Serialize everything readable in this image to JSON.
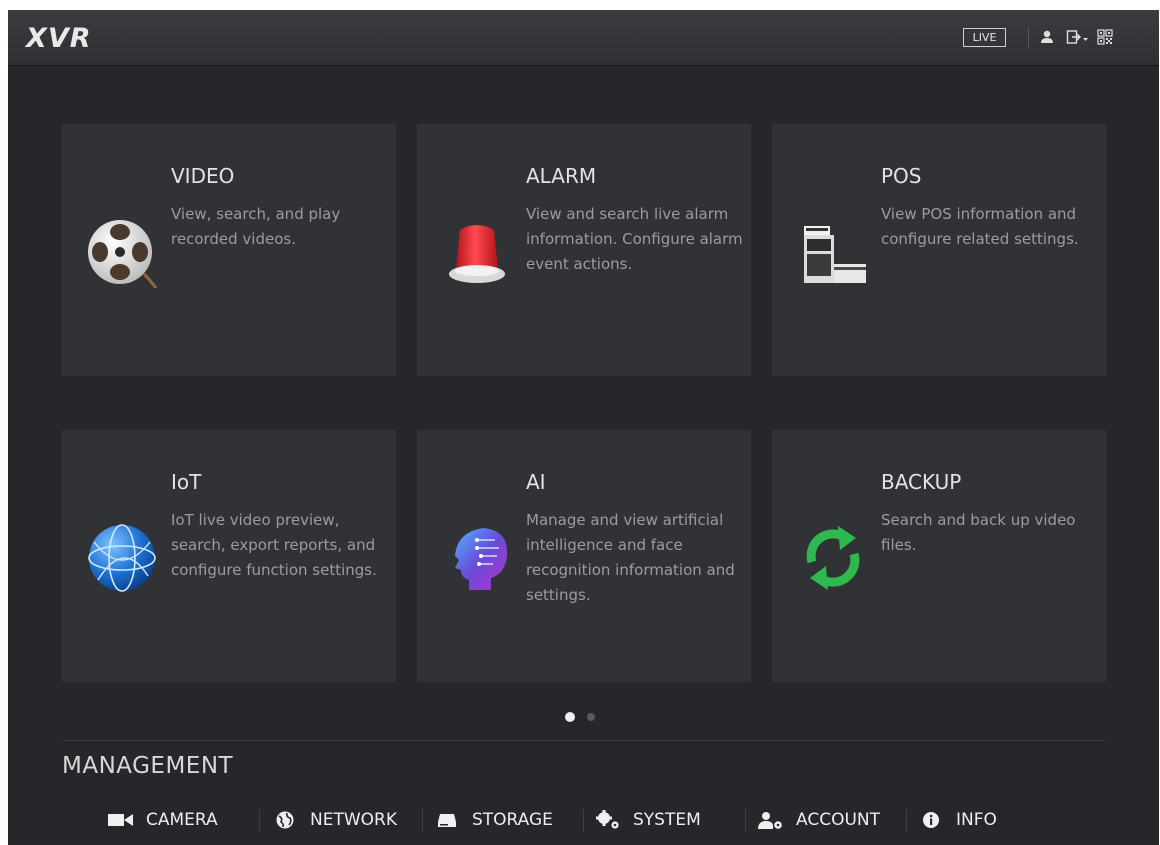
{
  "header": {
    "logo": "XVR",
    "live_label": "LIVE",
    "icons": [
      "user-icon",
      "logout-icon",
      "qr-code-icon"
    ]
  },
  "tiles": [
    {
      "title": "VIDEO",
      "description": "View, search, and play recorded videos.",
      "icon": "film-reel-icon"
    },
    {
      "title": "ALARM",
      "description": "View and search live alarm information. Configure alarm event actions.",
      "icon": "alarm-siren-icon"
    },
    {
      "title": "POS",
      "description": "View POS information and configure related settings.",
      "icon": "cash-register-icon"
    },
    {
      "title": "IoT",
      "description": "IoT live video preview, search, export reports, and configure function settings.",
      "icon": "globe-icon"
    },
    {
      "title": "AI",
      "description": "Manage and view artificial intelligence and face recognition information and settings.",
      "icon": "ai-head-icon"
    },
    {
      "title": "BACKUP",
      "description": "Search and back up video files.",
      "icon": "sync-arrows-icon"
    }
  ],
  "pager": {
    "pages": 2,
    "current": 1
  },
  "management": {
    "title": "MANAGEMENT",
    "items": [
      {
        "label": "CAMERA",
        "icon": "camera-icon"
      },
      {
        "label": "NETWORK",
        "icon": "network-globe-icon"
      },
      {
        "label": "STORAGE",
        "icon": "hard-disk-icon"
      },
      {
        "label": "SYSTEM",
        "icon": "gears-icon"
      },
      {
        "label": "ACCOUNT",
        "icon": "user-settings-icon"
      },
      {
        "label": "INFO",
        "icon": "info-icon"
      }
    ]
  },
  "colors": {
    "background": "#26272b",
    "tile": "#313236",
    "alarm_red": "#e8262b",
    "backup_green": "#2fb84f",
    "globe_blue": "#1d6fd0"
  }
}
